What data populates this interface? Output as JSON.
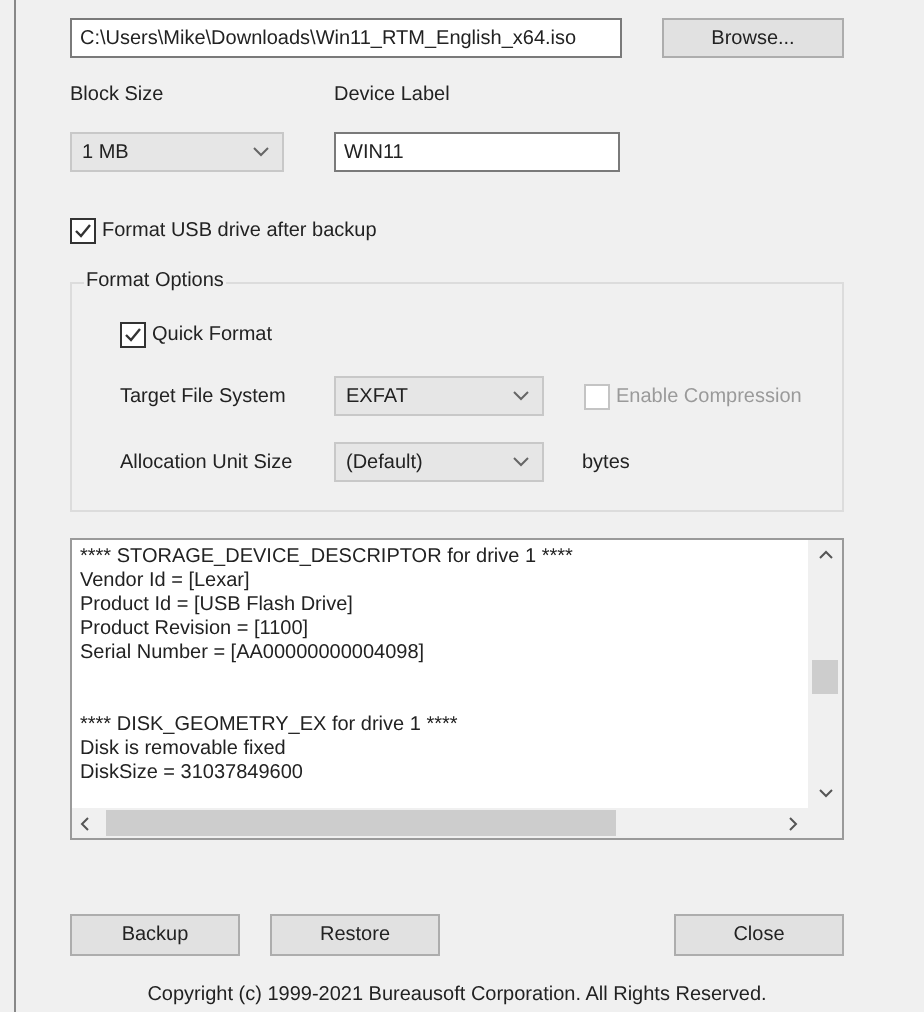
{
  "source": {
    "path": "C:\\Users\\Mike\\Downloads\\Win11_RTM_English_x64.iso",
    "browse_button": "Browse..."
  },
  "block_size": {
    "label": "Block Size",
    "value": "1 MB"
  },
  "device_label": {
    "label": "Device Label",
    "value": "WIN11"
  },
  "format_after_backup": {
    "label": "Format USB drive after backup",
    "checked": true
  },
  "format_options": {
    "title": "Format Options",
    "quick_format": {
      "label": "Quick Format",
      "checked": true
    },
    "target_file_system": {
      "label": "Target File System",
      "value": "EXFAT"
    },
    "enable_compression": {
      "label": "Enable Compression",
      "checked": false,
      "disabled": true
    },
    "allocation_unit_size": {
      "label": "Allocation Unit Size",
      "value": "(Default)",
      "unit": "bytes"
    }
  },
  "log": {
    "blocks": [
      [
        "**** STORAGE_DEVICE_DESCRIPTOR for drive 1 ****",
        "Vendor Id = [Lexar]",
        "Product Id = [USB Flash Drive]",
        "Product Revision = [1100]",
        "Serial Number = [AA00000000004098]"
      ],
      [
        "**** DISK_GEOMETRY_EX for drive 1 ****",
        "Disk is removable fixed",
        "DiskSize = 31037849600"
      ]
    ]
  },
  "action_buttons": [
    "Backup",
    "Restore"
  ],
  "close_button": "Close",
  "copyright": "Copyright (c) 1999-2021 Bureausoft Corporation. All Rights Reserved."
}
